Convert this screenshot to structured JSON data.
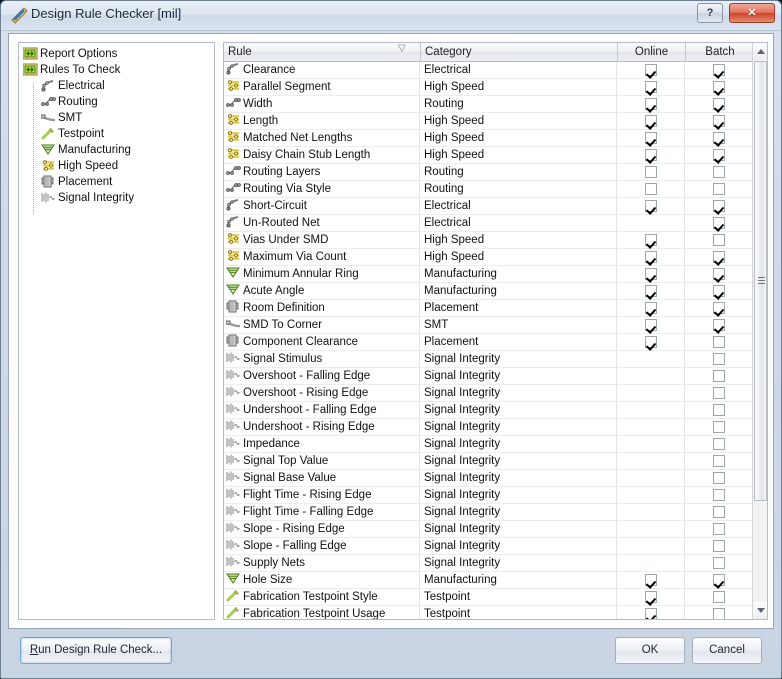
{
  "window": {
    "title": "Design Rule Checker [mil]",
    "title_icon": "ruler-pencil-icon",
    "help_label": "?",
    "close_label": "✕"
  },
  "sidebar": {
    "items": [
      {
        "label": "Report Options",
        "icon": "folder-icon",
        "level": 0
      },
      {
        "label": "Rules To Check",
        "icon": "folder-icon",
        "level": 0
      },
      {
        "label": "Electrical",
        "icon": "electrical-icon",
        "level": 1
      },
      {
        "label": "Routing",
        "icon": "routing-icon",
        "level": 1
      },
      {
        "label": "SMT",
        "icon": "smt-icon",
        "level": 1
      },
      {
        "label": "Testpoint",
        "icon": "testpoint-icon",
        "level": 1
      },
      {
        "label": "Manufacturing",
        "icon": "manufacturing-icon",
        "level": 1
      },
      {
        "label": "High Speed",
        "icon": "high-speed-icon",
        "level": 1
      },
      {
        "label": "Placement",
        "icon": "placement-icon",
        "level": 1
      },
      {
        "label": "Signal Integrity",
        "icon": "signal-integrity-icon",
        "level": 1
      }
    ]
  },
  "grid": {
    "columns": [
      {
        "key": "rule",
        "label": "Rule",
        "sort": "descending"
      },
      {
        "key": "category",
        "label": "Category"
      },
      {
        "key": "online",
        "label": "Online"
      },
      {
        "key": "batch",
        "label": "Batch"
      }
    ],
    "rows": [
      {
        "rule": "Clearance",
        "category": "Electrical",
        "icon": "electrical-icon",
        "online": "checked",
        "batch": "checked"
      },
      {
        "rule": "Parallel Segment",
        "category": "High Speed",
        "icon": "high-speed-icon",
        "online": "checked",
        "batch": "checked"
      },
      {
        "rule": "Width",
        "category": "Routing",
        "icon": "routing-icon",
        "online": "checked",
        "batch": "checked"
      },
      {
        "rule": "Length",
        "category": "High Speed",
        "icon": "high-speed-icon",
        "online": "checked",
        "batch": "checked"
      },
      {
        "rule": "Matched Net Lengths",
        "category": "High Speed",
        "icon": "high-speed-icon",
        "online": "checked",
        "batch": "checked"
      },
      {
        "rule": "Daisy Chain Stub Length",
        "category": "High Speed",
        "icon": "high-speed-icon",
        "online": "checked",
        "batch": "checked"
      },
      {
        "rule": "Routing Layers",
        "category": "Routing",
        "icon": "routing-icon",
        "online": "unchecked",
        "batch": "unchecked"
      },
      {
        "rule": "Routing Via Style",
        "category": "Routing",
        "icon": "routing-icon",
        "online": "unchecked",
        "batch": "unchecked"
      },
      {
        "rule": "Short-Circuit",
        "category": "Electrical",
        "icon": "electrical-icon",
        "online": "checked",
        "batch": "checked"
      },
      {
        "rule": "Un-Routed Net",
        "category": "Electrical",
        "icon": "electrical-icon",
        "online": "none",
        "batch": "checked"
      },
      {
        "rule": "Vias Under SMD",
        "category": "High Speed",
        "icon": "high-speed-icon",
        "online": "checked",
        "batch": "unchecked"
      },
      {
        "rule": "Maximum Via Count",
        "category": "High Speed",
        "icon": "high-speed-icon",
        "online": "checked",
        "batch": "checked"
      },
      {
        "rule": "Minimum Annular Ring",
        "category": "Manufacturing",
        "icon": "manufacturing-icon",
        "online": "checked",
        "batch": "checked"
      },
      {
        "rule": "Acute Angle",
        "category": "Manufacturing",
        "icon": "manufacturing-icon",
        "online": "checked",
        "batch": "checked"
      },
      {
        "rule": "Room Definition",
        "category": "Placement",
        "icon": "placement-icon",
        "online": "checked",
        "batch": "checked"
      },
      {
        "rule": "SMD To Corner",
        "category": "SMT",
        "icon": "smt-icon",
        "online": "checked",
        "batch": "checked"
      },
      {
        "rule": "Component Clearance",
        "category": "Placement",
        "icon": "placement-icon",
        "online": "checked",
        "batch": "unchecked"
      },
      {
        "rule": "Signal Stimulus",
        "category": "Signal Integrity",
        "icon": "signal-integrity-icon",
        "online": "none",
        "batch": "unchecked"
      },
      {
        "rule": "Overshoot - Falling Edge",
        "category": "Signal Integrity",
        "icon": "signal-integrity-icon",
        "online": "none",
        "batch": "unchecked"
      },
      {
        "rule": "Overshoot - Rising Edge",
        "category": "Signal Integrity",
        "icon": "signal-integrity-icon",
        "online": "none",
        "batch": "unchecked"
      },
      {
        "rule": "Undershoot - Falling Edge",
        "category": "Signal Integrity",
        "icon": "signal-integrity-icon",
        "online": "none",
        "batch": "unchecked"
      },
      {
        "rule": "Undershoot - Rising Edge",
        "category": "Signal Integrity",
        "icon": "signal-integrity-icon",
        "online": "none",
        "batch": "unchecked"
      },
      {
        "rule": "Impedance",
        "category": "Signal Integrity",
        "icon": "signal-integrity-icon",
        "online": "none",
        "batch": "unchecked"
      },
      {
        "rule": "Signal Top Value",
        "category": "Signal Integrity",
        "icon": "signal-integrity-icon",
        "online": "none",
        "batch": "unchecked"
      },
      {
        "rule": "Signal Base Value",
        "category": "Signal Integrity",
        "icon": "signal-integrity-icon",
        "online": "none",
        "batch": "unchecked"
      },
      {
        "rule": "Flight Time - Rising Edge",
        "category": "Signal Integrity",
        "icon": "signal-integrity-icon",
        "online": "none",
        "batch": "unchecked"
      },
      {
        "rule": "Flight Time - Falling Edge",
        "category": "Signal Integrity",
        "icon": "signal-integrity-icon",
        "online": "none",
        "batch": "unchecked"
      },
      {
        "rule": "Slope - Rising Edge",
        "category": "Signal Integrity",
        "icon": "signal-integrity-icon",
        "online": "none",
        "batch": "unchecked"
      },
      {
        "rule": "Slope - Falling Edge",
        "category": "Signal Integrity",
        "icon": "signal-integrity-icon",
        "online": "none",
        "batch": "unchecked"
      },
      {
        "rule": "Supply Nets",
        "category": "Signal Integrity",
        "icon": "signal-integrity-icon",
        "online": "none",
        "batch": "unchecked"
      },
      {
        "rule": "Hole Size",
        "category": "Manufacturing",
        "icon": "manufacturing-icon",
        "online": "checked",
        "batch": "checked"
      },
      {
        "rule": "Fabrication Testpoint Style",
        "category": "Testpoint",
        "icon": "testpoint-icon",
        "online": "checked",
        "batch": "unchecked"
      },
      {
        "rule": "Fabrication Testpoint Usage",
        "category": "Testpoint",
        "icon": "testpoint-icon",
        "online": "checked",
        "batch": "unchecked"
      }
    ]
  },
  "footer": {
    "run_label": "Run Design Rule Check...",
    "run_accel": "R",
    "ok_label": "OK",
    "cancel_label": "Cancel"
  },
  "colors": {
    "accent": "#6ea5d8",
    "close": "#cf4326",
    "icon_yellow": "#e8d44a",
    "icon_green": "#9ede3e"
  }
}
